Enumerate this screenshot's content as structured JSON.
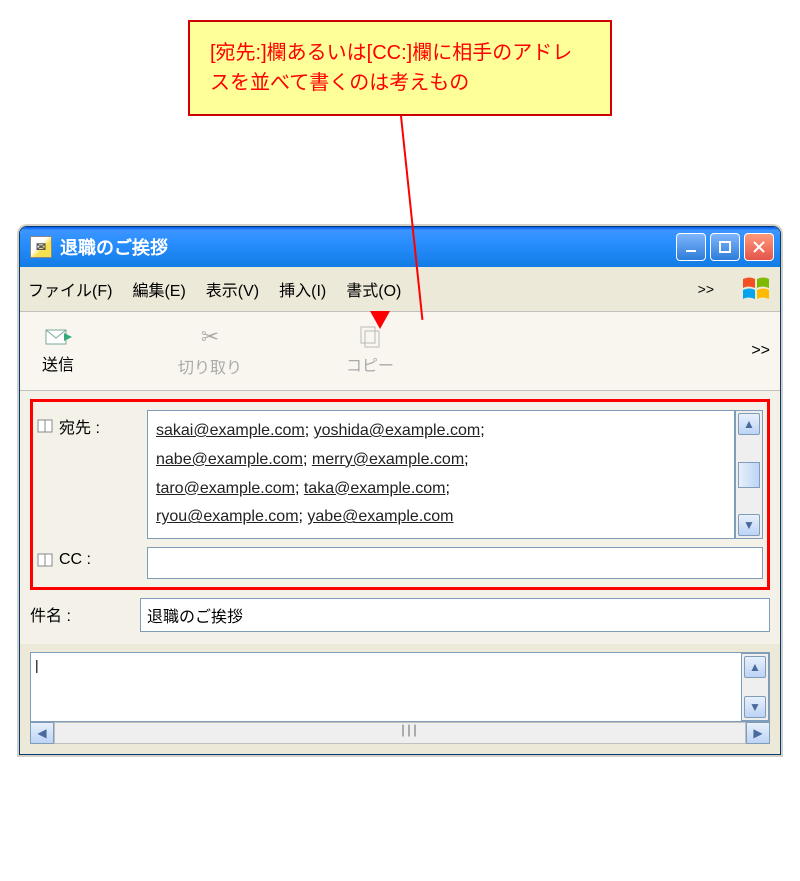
{
  "callout": {
    "text": "[宛先:]欄あるいは[CC:]欄に相手のアドレスを並べて書くのは考えもの"
  },
  "window": {
    "title": "退職のご挨拶"
  },
  "menu": {
    "file": "ファイル(F)",
    "edit": "編集(E)",
    "view": "表示(V)",
    "insert": "挿入(I)",
    "format": "書式(O)",
    "more": ">>"
  },
  "toolbar": {
    "send": "送信",
    "cut": "切り取り",
    "copy": "コピー",
    "more": ">>"
  },
  "fields": {
    "to_label": "宛先 :",
    "cc_label": "CC :",
    "subject_label": "件名 :",
    "subject_value": "退職のご挨拶",
    "to_addresses": [
      "sakai@example.com",
      "yoshida@example.com",
      "nabe@example.com",
      "merry@example.com",
      "taro@example.com",
      "taka@example.com",
      "ryou@example.com",
      "yabe@example.com"
    ]
  }
}
